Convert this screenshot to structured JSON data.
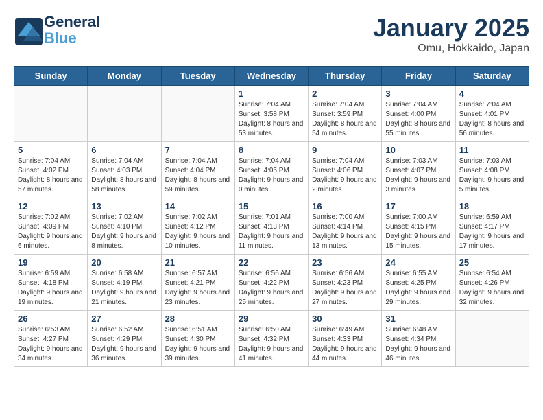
{
  "header": {
    "logo_line1": "General",
    "logo_line2": "Blue",
    "title": "January 2025",
    "subtitle": "Omu, Hokkaido, Japan"
  },
  "weekdays": [
    "Sunday",
    "Monday",
    "Tuesday",
    "Wednesday",
    "Thursday",
    "Friday",
    "Saturday"
  ],
  "weeks": [
    [
      {
        "day": "",
        "info": ""
      },
      {
        "day": "",
        "info": ""
      },
      {
        "day": "",
        "info": ""
      },
      {
        "day": "1",
        "info": "Sunrise: 7:04 AM\nSunset: 3:58 PM\nDaylight: 8 hours and 53 minutes."
      },
      {
        "day": "2",
        "info": "Sunrise: 7:04 AM\nSunset: 3:59 PM\nDaylight: 8 hours and 54 minutes."
      },
      {
        "day": "3",
        "info": "Sunrise: 7:04 AM\nSunset: 4:00 PM\nDaylight: 8 hours and 55 minutes."
      },
      {
        "day": "4",
        "info": "Sunrise: 7:04 AM\nSunset: 4:01 PM\nDaylight: 8 hours and 56 minutes."
      }
    ],
    [
      {
        "day": "5",
        "info": "Sunrise: 7:04 AM\nSunset: 4:02 PM\nDaylight: 8 hours and 57 minutes."
      },
      {
        "day": "6",
        "info": "Sunrise: 7:04 AM\nSunset: 4:03 PM\nDaylight: 8 hours and 58 minutes."
      },
      {
        "day": "7",
        "info": "Sunrise: 7:04 AM\nSunset: 4:04 PM\nDaylight: 8 hours and 59 minutes."
      },
      {
        "day": "8",
        "info": "Sunrise: 7:04 AM\nSunset: 4:05 PM\nDaylight: 9 hours and 0 minutes."
      },
      {
        "day": "9",
        "info": "Sunrise: 7:04 AM\nSunset: 4:06 PM\nDaylight: 9 hours and 2 minutes."
      },
      {
        "day": "10",
        "info": "Sunrise: 7:03 AM\nSunset: 4:07 PM\nDaylight: 9 hours and 3 minutes."
      },
      {
        "day": "11",
        "info": "Sunrise: 7:03 AM\nSunset: 4:08 PM\nDaylight: 9 hours and 5 minutes."
      }
    ],
    [
      {
        "day": "12",
        "info": "Sunrise: 7:02 AM\nSunset: 4:09 PM\nDaylight: 9 hours and 6 minutes."
      },
      {
        "day": "13",
        "info": "Sunrise: 7:02 AM\nSunset: 4:10 PM\nDaylight: 9 hours and 8 minutes."
      },
      {
        "day": "14",
        "info": "Sunrise: 7:02 AM\nSunset: 4:12 PM\nDaylight: 9 hours and 10 minutes."
      },
      {
        "day": "15",
        "info": "Sunrise: 7:01 AM\nSunset: 4:13 PM\nDaylight: 9 hours and 11 minutes."
      },
      {
        "day": "16",
        "info": "Sunrise: 7:00 AM\nSunset: 4:14 PM\nDaylight: 9 hours and 13 minutes."
      },
      {
        "day": "17",
        "info": "Sunrise: 7:00 AM\nSunset: 4:15 PM\nDaylight: 9 hours and 15 minutes."
      },
      {
        "day": "18",
        "info": "Sunrise: 6:59 AM\nSunset: 4:17 PM\nDaylight: 9 hours and 17 minutes."
      }
    ],
    [
      {
        "day": "19",
        "info": "Sunrise: 6:59 AM\nSunset: 4:18 PM\nDaylight: 9 hours and 19 minutes."
      },
      {
        "day": "20",
        "info": "Sunrise: 6:58 AM\nSunset: 4:19 PM\nDaylight: 9 hours and 21 minutes."
      },
      {
        "day": "21",
        "info": "Sunrise: 6:57 AM\nSunset: 4:21 PM\nDaylight: 9 hours and 23 minutes."
      },
      {
        "day": "22",
        "info": "Sunrise: 6:56 AM\nSunset: 4:22 PM\nDaylight: 9 hours and 25 minutes."
      },
      {
        "day": "23",
        "info": "Sunrise: 6:56 AM\nSunset: 4:23 PM\nDaylight: 9 hours and 27 minutes."
      },
      {
        "day": "24",
        "info": "Sunrise: 6:55 AM\nSunset: 4:25 PM\nDaylight: 9 hours and 29 minutes."
      },
      {
        "day": "25",
        "info": "Sunrise: 6:54 AM\nSunset: 4:26 PM\nDaylight: 9 hours and 32 minutes."
      }
    ],
    [
      {
        "day": "26",
        "info": "Sunrise: 6:53 AM\nSunset: 4:27 PM\nDaylight: 9 hours and 34 minutes."
      },
      {
        "day": "27",
        "info": "Sunrise: 6:52 AM\nSunset: 4:29 PM\nDaylight: 9 hours and 36 minutes."
      },
      {
        "day": "28",
        "info": "Sunrise: 6:51 AM\nSunset: 4:30 PM\nDaylight: 9 hours and 39 minutes."
      },
      {
        "day": "29",
        "info": "Sunrise: 6:50 AM\nSunset: 4:32 PM\nDaylight: 9 hours and 41 minutes."
      },
      {
        "day": "30",
        "info": "Sunrise: 6:49 AM\nSunset: 4:33 PM\nDaylight: 9 hours and 44 minutes."
      },
      {
        "day": "31",
        "info": "Sunrise: 6:48 AM\nSunset: 4:34 PM\nDaylight: 9 hours and 46 minutes."
      },
      {
        "day": "",
        "info": ""
      }
    ]
  ]
}
